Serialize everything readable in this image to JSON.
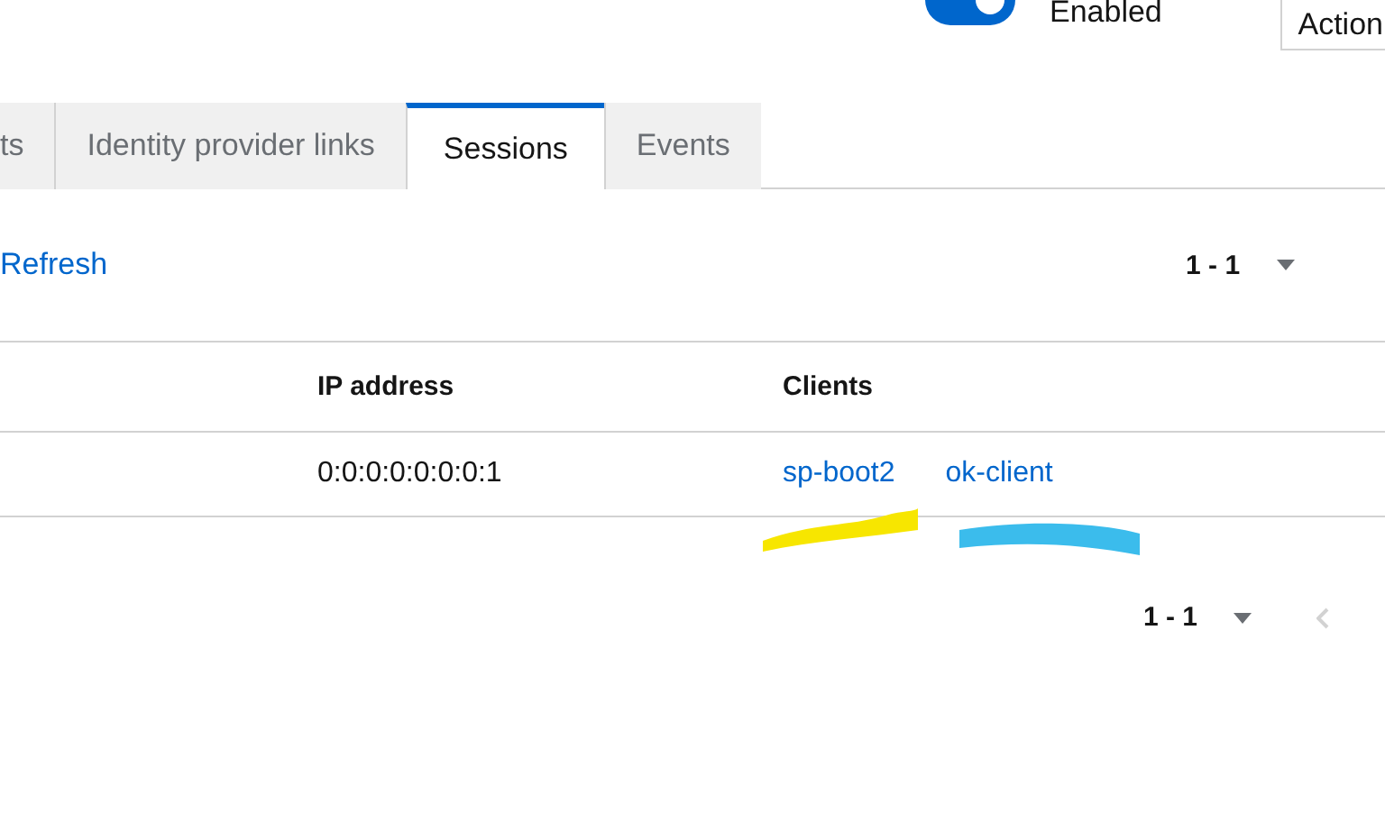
{
  "header": {
    "switch": {
      "label": "Enabled",
      "on": true
    },
    "action_button": "Action"
  },
  "tabs": [
    {
      "label": "ts",
      "selected": false
    },
    {
      "label": "Identity provider links",
      "selected": false
    },
    {
      "label": "Sessions",
      "selected": true
    },
    {
      "label": "Events",
      "selected": false
    }
  ],
  "toolbar": {
    "refresh": "Refresh",
    "pagination": "1 - 1"
  },
  "table": {
    "columns": [
      "IP address",
      "Clients"
    ],
    "rows": [
      {
        "ip": "0:0:0:0:0:0:0:1",
        "clients": [
          "sp-boot2",
          "ok-client"
        ]
      }
    ]
  },
  "annotations": [
    {
      "color": "#f7e600"
    },
    {
      "color": "#3bbcec"
    }
  ],
  "footer": {
    "pagination": "1 - 1"
  }
}
